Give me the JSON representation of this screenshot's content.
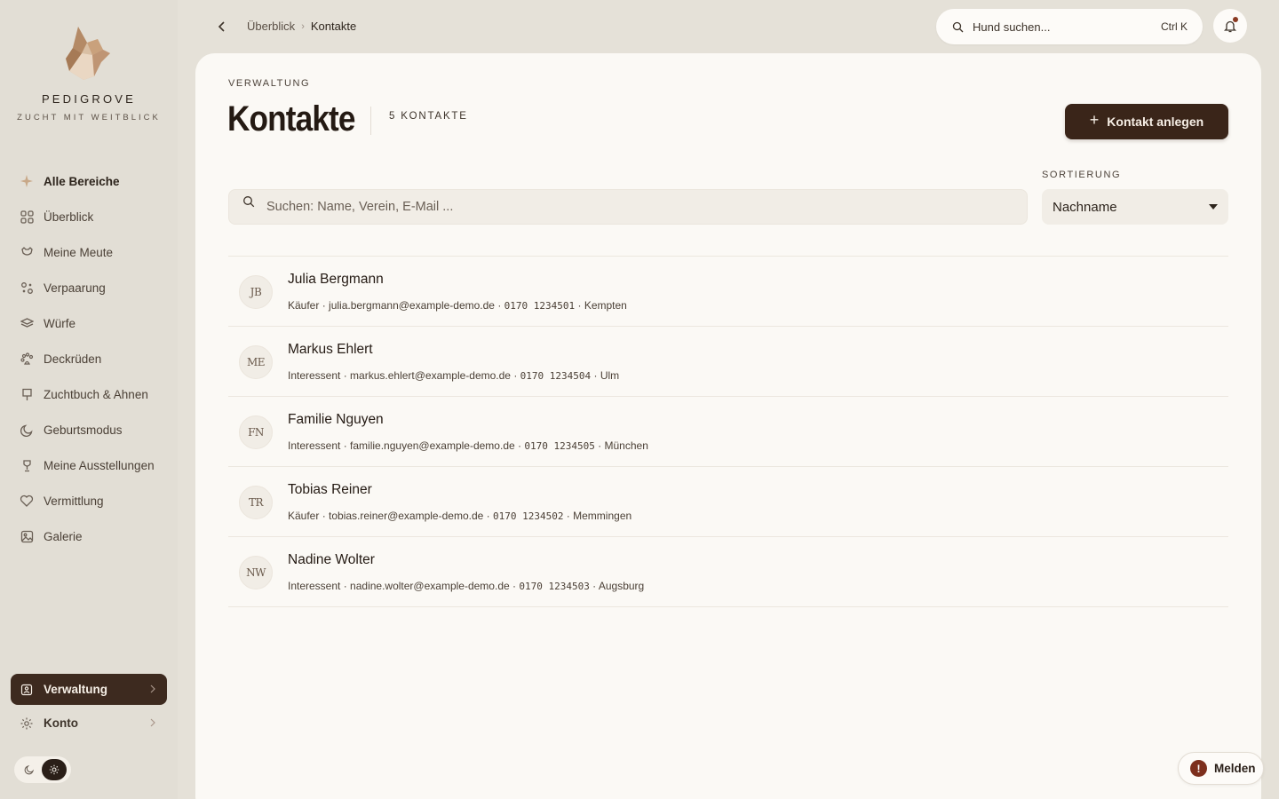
{
  "brand": {
    "name": "PEDIGROVE",
    "tagline": "ZUCHT MIT WEITBLICK",
    "logo_icon": "fox-head-logo"
  },
  "sidebar": {
    "items": [
      {
        "label": "Alle Bereiche",
        "icon": "sparkle-icon"
      },
      {
        "label": "Überblick",
        "icon": "grid-icon"
      },
      {
        "label": "Meine Meute",
        "icon": "dog-head-icon"
      },
      {
        "label": "Verpaarung",
        "icon": "pairing-icon"
      },
      {
        "label": "Würfe",
        "icon": "layers-icon"
      },
      {
        "label": "Deckrüden",
        "icon": "paw-icon"
      },
      {
        "label": "Zuchtbuch & Ahnen",
        "icon": "book-icon"
      },
      {
        "label": "Geburtsmodus",
        "icon": "moon-icon"
      },
      {
        "label": "Meine Ausstellungen",
        "icon": "trophy-icon"
      },
      {
        "label": "Vermittlung",
        "icon": "heart-icon"
      },
      {
        "label": "Galerie",
        "icon": "image-icon"
      }
    ],
    "bottom": [
      {
        "label": "Verwaltung",
        "icon": "admin-icon",
        "active": true
      },
      {
        "label": "Konto",
        "icon": "gear-icon",
        "active": false
      }
    ]
  },
  "breadcrumb": {
    "parent": "Überblick",
    "separator": "›",
    "current": "Kontakte"
  },
  "global_search": {
    "placeholder": "Hund suchen...",
    "shortcut": "Ctrl K"
  },
  "page": {
    "eyebrow": "VERWALTUNG",
    "title": "Kontakte",
    "count": "5 KONTAKTE",
    "add_button": "Kontakt anlegen",
    "add_plus": "+",
    "search_placeholder": "Suchen: Name, Verein, E-Mail ...",
    "sort_label": "SORTIERUNG",
    "sort_value": "Nachname"
  },
  "contacts": [
    {
      "initials": "JB",
      "name": "Julia Bergmann",
      "role": "Käufer",
      "email": "julia.bergmann@example-demo.de",
      "phone": "0170 1234501",
      "city": "Kempten"
    },
    {
      "initials": "ME",
      "name": "Markus Ehlert",
      "role": "Interessent",
      "email": "markus.ehlert@example-demo.de",
      "phone": "0170 1234504",
      "city": "Ulm"
    },
    {
      "initials": "FN",
      "name": "Familie Nguyen",
      "role": "Interessent",
      "email": "familie.nguyen@example-demo.de",
      "phone": "0170 1234505",
      "city": "München"
    },
    {
      "initials": "TR",
      "name": "Tobias Reiner",
      "role": "Käufer",
      "email": "tobias.reiner@example-demo.de",
      "phone": "0170 1234502",
      "city": "Memmingen"
    },
    {
      "initials": "NW",
      "name": "Nadine Wolter",
      "role": "Interessent",
      "email": "nadine.wolter@example-demo.de",
      "phone": "0170 1234503",
      "city": "Augsburg"
    }
  ],
  "meta_separator": " · ",
  "report": {
    "label": "Melden",
    "icon_glyph": "!"
  },
  "colors": {
    "accent_dark": "#3a2519",
    "alert": "#7d2f1d",
    "panel": "#fbf9f5",
    "background": "#e5e1d8"
  }
}
